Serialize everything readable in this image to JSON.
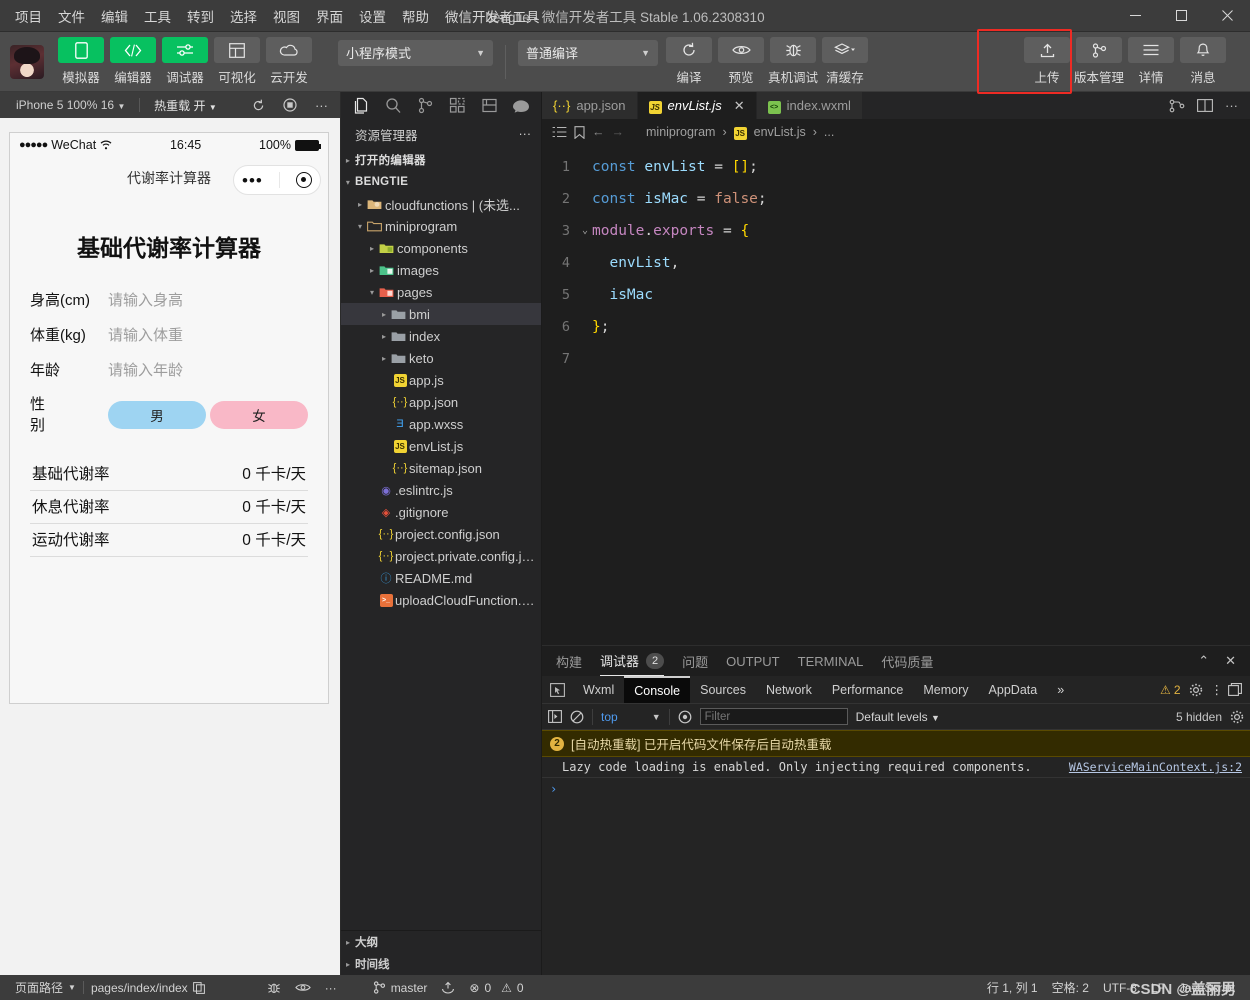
{
  "titlebar": {
    "menus": [
      "项目",
      "文件",
      "编辑",
      "工具",
      "转到",
      "选择",
      "视图",
      "界面",
      "设置",
      "帮助",
      "微信开发者工具"
    ],
    "title": "bengtie - 微信开发者工具 Stable 1.06.2308310",
    "minimize": "—",
    "maximize": "☐",
    "close": "✕"
  },
  "toolbar": {
    "left_buttons": [
      {
        "label": "模拟器",
        "icon": "phone-icon",
        "active": true
      },
      {
        "label": "编辑器",
        "icon": "code-icon",
        "active": true
      },
      {
        "label": "调试器",
        "icon": "sliders-icon",
        "active": true
      },
      {
        "label": "可视化",
        "icon": "layout-icon",
        "active": false
      },
      {
        "label": "云开发",
        "icon": "cloud-icon",
        "active": false
      }
    ],
    "mode_select": "小程序模式",
    "compile_select": "普通编译",
    "actions": [
      {
        "label": "编译",
        "icon": "refresh-icon"
      },
      {
        "label": "预览",
        "icon": "eye-icon"
      },
      {
        "label": "真机调试",
        "icon": "bug-icon"
      },
      {
        "label": "清缓存",
        "icon": "layers-icon"
      }
    ],
    "right_buttons": [
      {
        "label": "上传",
        "icon": "upload-icon"
      },
      {
        "label": "版本管理",
        "icon": "branch-icon"
      },
      {
        "label": "详情",
        "icon": "menu-icon"
      },
      {
        "label": "消息",
        "icon": "bell-icon"
      }
    ],
    "highlight_color": "#ee2b24"
  },
  "simulator": {
    "toolbar": {
      "device": "iPhone 5 100% 16",
      "hot_reload": "热重载 开",
      "refresh_icon": "refresh-icon",
      "record_icon": "record-icon",
      "more": "···"
    },
    "status_bar": {
      "carrier_dots": "●●●●●",
      "carrier": "WeChat",
      "wifi_icon": "wifi-icon",
      "time": "16:45",
      "battery_text": "100%"
    },
    "nav_title": "代谢率计算器",
    "page": {
      "heading": "基础代谢率计算器",
      "fields": [
        {
          "label": "身高(cm)",
          "placeholder": "请输入身高",
          "value": ""
        },
        {
          "label": "体重(kg)",
          "placeholder": "请输入体重",
          "value": ""
        },
        {
          "label": "年龄",
          "placeholder": "请输入年龄",
          "value": ""
        }
      ],
      "gender": {
        "label": "性别",
        "male": "男",
        "female": "女",
        "male_color": "#9ed4f2",
        "female_color": "#f9b8c7"
      },
      "results": [
        {
          "label": "基础代谢率",
          "value": "0 千卡/天"
        },
        {
          "label": "休息代谢率",
          "value": "0 千卡/天"
        },
        {
          "label": "运动代谢率",
          "value": "0 千卡/天"
        }
      ]
    }
  },
  "explorer": {
    "activity_icons": [
      "files-icon",
      "search-icon",
      "source-control-icon",
      "extensions-icon",
      "save-icon",
      "miniprogram-icon"
    ],
    "header": "资源管理器",
    "header_more": "···",
    "tree": [
      {
        "name": "打开的编辑器",
        "type": "section",
        "twisty": "▸",
        "indent": 0
      },
      {
        "name": "BENGTIE",
        "type": "section",
        "twisty": "▾",
        "indent": 0
      },
      {
        "name": "cloudfunctions | (未选...",
        "type": "folder-cloud",
        "twisty": "▸",
        "indent": 1
      },
      {
        "name": "miniprogram",
        "type": "folder-open",
        "twisty": "▾",
        "indent": 1
      },
      {
        "name": "components",
        "type": "folder-components",
        "twisty": "▸",
        "indent": 2
      },
      {
        "name": "images",
        "type": "folder-images",
        "twisty": "▸",
        "indent": 2
      },
      {
        "name": "pages",
        "type": "folder-pages",
        "twisty": "▾",
        "indent": 2
      },
      {
        "name": "bmi",
        "type": "folder-plain",
        "twisty": "▸",
        "indent": 3,
        "selected": true
      },
      {
        "name": "index",
        "type": "folder-plain",
        "twisty": "▸",
        "indent": 3
      },
      {
        "name": "keto",
        "type": "folder-plain",
        "twisty": "▸",
        "indent": 3
      },
      {
        "name": "app.js",
        "type": "js",
        "twisty": "",
        "indent": 3
      },
      {
        "name": "app.json",
        "type": "json",
        "twisty": "",
        "indent": 3
      },
      {
        "name": "app.wxss",
        "type": "css",
        "twisty": "",
        "indent": 3
      },
      {
        "name": "envList.js",
        "type": "js",
        "twisty": "",
        "indent": 3
      },
      {
        "name": "sitemap.json",
        "type": "json",
        "twisty": "",
        "indent": 3
      },
      {
        "name": ".eslintrc.js",
        "type": "eslint",
        "twisty": "",
        "indent": 2
      },
      {
        "name": ".gitignore",
        "type": "git",
        "twisty": "",
        "indent": 2
      },
      {
        "name": "project.config.json",
        "type": "json",
        "twisty": "",
        "indent": 2
      },
      {
        "name": "project.private.config.js...",
        "type": "json",
        "twisty": "",
        "indent": 2
      },
      {
        "name": "README.md",
        "type": "md",
        "twisty": "",
        "indent": 2
      },
      {
        "name": "uploadCloudFunction.sh",
        "type": "sh",
        "twisty": "",
        "indent": 2
      }
    ],
    "bottom_sections": [
      {
        "name": "大纲",
        "twisty": "▸"
      },
      {
        "name": "时间线",
        "twisty": "▸"
      }
    ]
  },
  "editor": {
    "tabs": [
      {
        "label": "app.json",
        "icon": "json-icon",
        "active": false,
        "closable": false
      },
      {
        "label": "envList.js",
        "icon": "js-icon",
        "active": true,
        "closable": true,
        "close": "✕"
      },
      {
        "label": "index.wxml",
        "icon": "wxml-icon",
        "active": false,
        "closable": false
      }
    ],
    "tab_actions": [
      "split-editor-icon",
      "layout-icon",
      "more-icon"
    ],
    "breadcrumb": {
      "icons": [
        "outline-icon",
        "bookmark-icon",
        "back-icon",
        "forward-icon"
      ],
      "path": [
        "miniprogram",
        "envList.js",
        "..."
      ],
      "separator": "›"
    },
    "code_lines": [
      {
        "n": "1",
        "fold": "",
        "tokens": [
          {
            "t": "const",
            "c": "k-key"
          },
          {
            "t": " ",
            "c": "k-op"
          },
          {
            "t": "envList",
            "c": "k-var"
          },
          {
            "t": " = ",
            "c": "k-op"
          },
          {
            "t": "[]",
            "c": "k-punc"
          },
          {
            "t": ";",
            "c": "k-op"
          }
        ]
      },
      {
        "n": "2",
        "fold": "",
        "tokens": [
          {
            "t": "const",
            "c": "k-key"
          },
          {
            "t": " ",
            "c": "k-op"
          },
          {
            "t": "isMac",
            "c": "k-var"
          },
          {
            "t": " = ",
            "c": "k-op"
          },
          {
            "t": "false",
            "c": "k-bool"
          },
          {
            "t": ";",
            "c": "k-op"
          }
        ]
      },
      {
        "n": "3",
        "fold": "⌄",
        "tokens": [
          {
            "t": "module",
            "c": "k-obj"
          },
          {
            "t": ".",
            "c": "k-op"
          },
          {
            "t": "exports",
            "c": "k-obj"
          },
          {
            "t": " = ",
            "c": "k-op"
          },
          {
            "t": "{",
            "c": "k-punc"
          }
        ]
      },
      {
        "n": "4",
        "fold": "",
        "tokens": [
          {
            "t": "  envList",
            "c": "k-prop"
          },
          {
            "t": ",",
            "c": "k-op"
          }
        ]
      },
      {
        "n": "5",
        "fold": "",
        "tokens": [
          {
            "t": "  isMac",
            "c": "k-prop"
          }
        ]
      },
      {
        "n": "6",
        "fold": "",
        "tokens": [
          {
            "t": "}",
            "c": "k-punc"
          },
          {
            "t": ";",
            "c": "k-op"
          }
        ]
      },
      {
        "n": "7",
        "fold": "",
        "tokens": []
      }
    ]
  },
  "panel": {
    "tabs": [
      {
        "label": "构建",
        "active": false
      },
      {
        "label": "调试器",
        "active": true,
        "badge": "2"
      },
      {
        "label": "问题",
        "active": false
      },
      {
        "label": "OUTPUT",
        "active": false
      },
      {
        "label": "TERMINAL",
        "active": false
      },
      {
        "label": "代码质量",
        "active": false
      }
    ],
    "collapse_icon": "chevron-up-icon",
    "close_icon": "close-icon",
    "devtools_tabs": [
      {
        "label": "Wxml",
        "active": false
      },
      {
        "label": "Console",
        "active": true
      },
      {
        "label": "Sources",
        "active": false
      },
      {
        "label": "Network",
        "active": false
      },
      {
        "label": "Performance",
        "active": false
      },
      {
        "label": "Memory",
        "active": false
      },
      {
        "label": "AppData",
        "active": false
      },
      {
        "label": "»",
        "active": false
      }
    ],
    "devtools_warning_count": "2",
    "console_toolbar": {
      "sidebar_icon": "console-sidebar-icon",
      "clear_icon": "clear-icon",
      "context": "top",
      "eye_icon": "eye-icon",
      "filter_placeholder": "Filter",
      "levels": "Default levels",
      "hidden": "5 hidden",
      "settings_icon": "gear-icon"
    },
    "console_entries": [
      {
        "type": "warning",
        "count": "2",
        "text": "[自动热重载] 已开启代码文件保存后自动热重载"
      },
      {
        "type": "log",
        "text": "Lazy code loading is enabled. Only injecting required components.",
        "source": "WAServiceMainContext.js:2"
      }
    ],
    "prompt": "›"
  },
  "statusbar": {
    "page_path_label": "页面路径",
    "page_path": "pages/index/index",
    "copy_icon": "copy-icon",
    "icons": [
      "bug-icon",
      "eye-icon",
      "more-icon"
    ],
    "branch": "master",
    "sync_icon": "sync-icon",
    "errors": "0",
    "warnings": "0",
    "cursor": "行 1, 列 1",
    "spaces": "空格: 2",
    "encoding": "UTF-8",
    "eol": "LF",
    "language": "JavaScript",
    "watermark": "CSDN @盖丽男"
  }
}
